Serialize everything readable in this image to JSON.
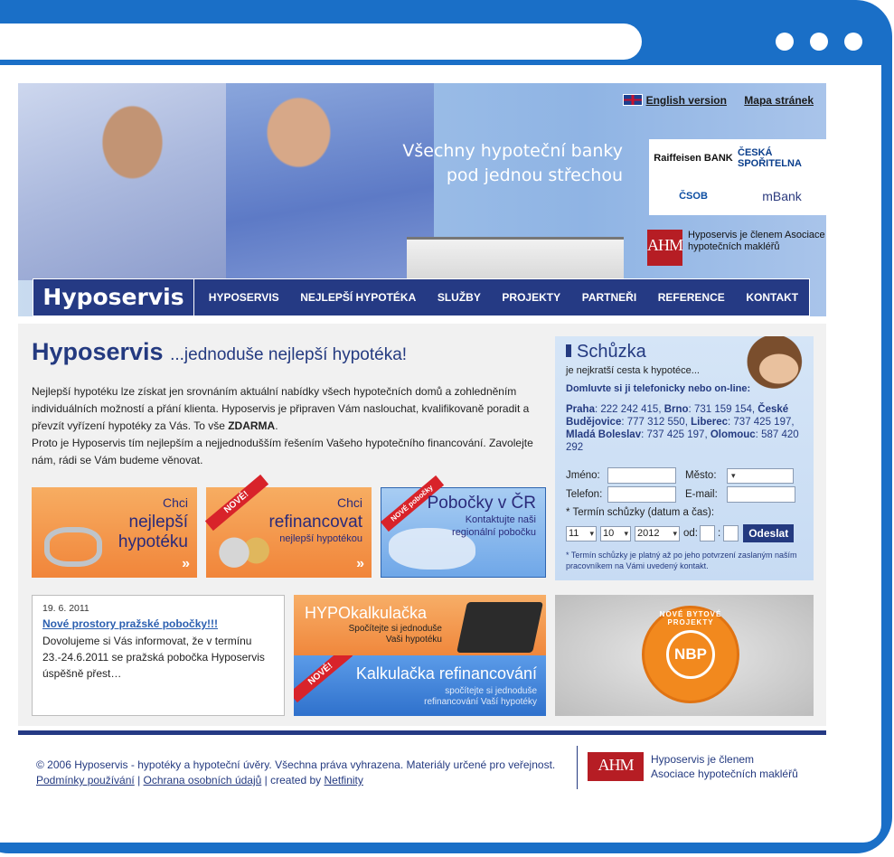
{
  "header": {
    "links": {
      "english": "English version",
      "sitemap": "Mapa stránek"
    },
    "slogan_line1": "Všechny hypoteční banky",
    "slogan_line2": "pod jednou střechou",
    "banks": [
      "Raiffeisen BANK",
      "ČESKÁ SPOŘITELNA",
      "ČSOB",
      "mBank"
    ],
    "ahm_logo_text": "AHM",
    "ahm_text": "Hyposervis je členem Asociace hypotečních makléřů"
  },
  "nav": {
    "brand": "Hyposervis",
    "items": [
      "HYPOSERVIS",
      "NEJLEPŠÍ HYPOTÉKA",
      "SLUŽBY",
      "PROJEKTY",
      "PARTNEŘI",
      "REFERENCE",
      "KONTAKT"
    ]
  },
  "intro": {
    "title_brand": "Hyposervis",
    "title_tagline": "...jednoduše nejlepší hypotéka!",
    "para1": "Nejlepší hypotéku lze získat jen srovnáním aktuální nabídky všech hypotečních domů a zohledněním individuálních možností a přání klienta. Hyposervis je připraven Vám naslouchat, kvalifikovaně poradit a převzít vyřízení hypotéky za Vás. To vše",
    "para1_bold": "ZDARMA",
    "para2": "Proto je Hyposervis tím nejlepším a nejjednodušším řešením Vašeho hypotečního financování. Zavolejte nám, rádi se Vám budeme věnovat."
  },
  "promos": {
    "p1": {
      "line1": "Chci",
      "line2": "nejlepší",
      "line3": "hypotéku",
      "arrow": "»"
    },
    "p2": {
      "ribbon": "NOVÉ!",
      "line1": "Chci",
      "line2": "refinancovat",
      "sub": "nejlepší hypotékou",
      "arrow": "»"
    },
    "p3": {
      "ribbon": "NOVÉ pobočky",
      "title": "Pobočky v ČR",
      "sub1": "Kontaktujte naši",
      "sub2": "regionální pobočku"
    }
  },
  "schuzka": {
    "title": "Schůzka",
    "lead": "je nejkratší cesta k hypotéce...",
    "call": "Domluvte si ji telefonicky nebo on-line:",
    "phones": [
      {
        "city": "Praha",
        "num": "222 242 415"
      },
      {
        "city": "Brno",
        "num": "731 159 154"
      },
      {
        "city": "České Budějovice",
        "num": "777 312 550"
      },
      {
        "city": "Liberec",
        "num": "737 425 197"
      },
      {
        "city": "Mladá Boleslav",
        "num": "737 425 197"
      },
      {
        "city": "Olomouc",
        "num": "587 420 292"
      }
    ],
    "label_name": "Jméno:",
    "label_city": "Město:",
    "label_phone": "Telefon:",
    "label_email": "E-mail:",
    "label_term": "* Termín schůzky (datum a čas):",
    "day": "11",
    "month": "10",
    "year": "2012",
    "label_from": "od:",
    "colon": ":",
    "send": "Odeslat",
    "note": "* Termín schůzky je platný až po jeho potvrzení zaslaným naším pracovníkem na Vámi uvedený kontakt."
  },
  "news": {
    "date": "19. 6. 2011",
    "headline": "Nové prostory pražské pobočky!!!",
    "body": "Dovolujeme si Vás informovat, že v termínu 23.-24.6.2011 se pražská pobočka Hyposervis úspěšně přest…"
  },
  "calc": {
    "title": "HYPOkalkulačka",
    "sub1": "Spočítejte si jednoduše",
    "sub2": "Vaši hypotéku",
    "ribbon": "NOVÉ!",
    "title2": "Kalkulačka refinancování",
    "sub3": "spočítejte si jednoduše",
    "sub4": "refinancování Vaší hypotéky"
  },
  "nbp": {
    "ring": "NOVÉ BYTOVÉ PROJEKTY",
    "center": "NBP"
  },
  "footer": {
    "copyright": "© 2006 Hyposervis - hypotéky a hypoteční úvěry. Všechna práva vyhrazena. Materiály určené pro veřejnost.",
    "link_terms": "Podmínky používání",
    "sep": "|",
    "link_privacy": "Ochrana osobních údajů",
    "created_by": "created by",
    "link_netfinity": "Netfinity",
    "ahm_logo_text": "AHM",
    "ahm_line1": "Hyposervis je členem",
    "ahm_line2": "Asociace hypotečních makléřů"
  }
}
